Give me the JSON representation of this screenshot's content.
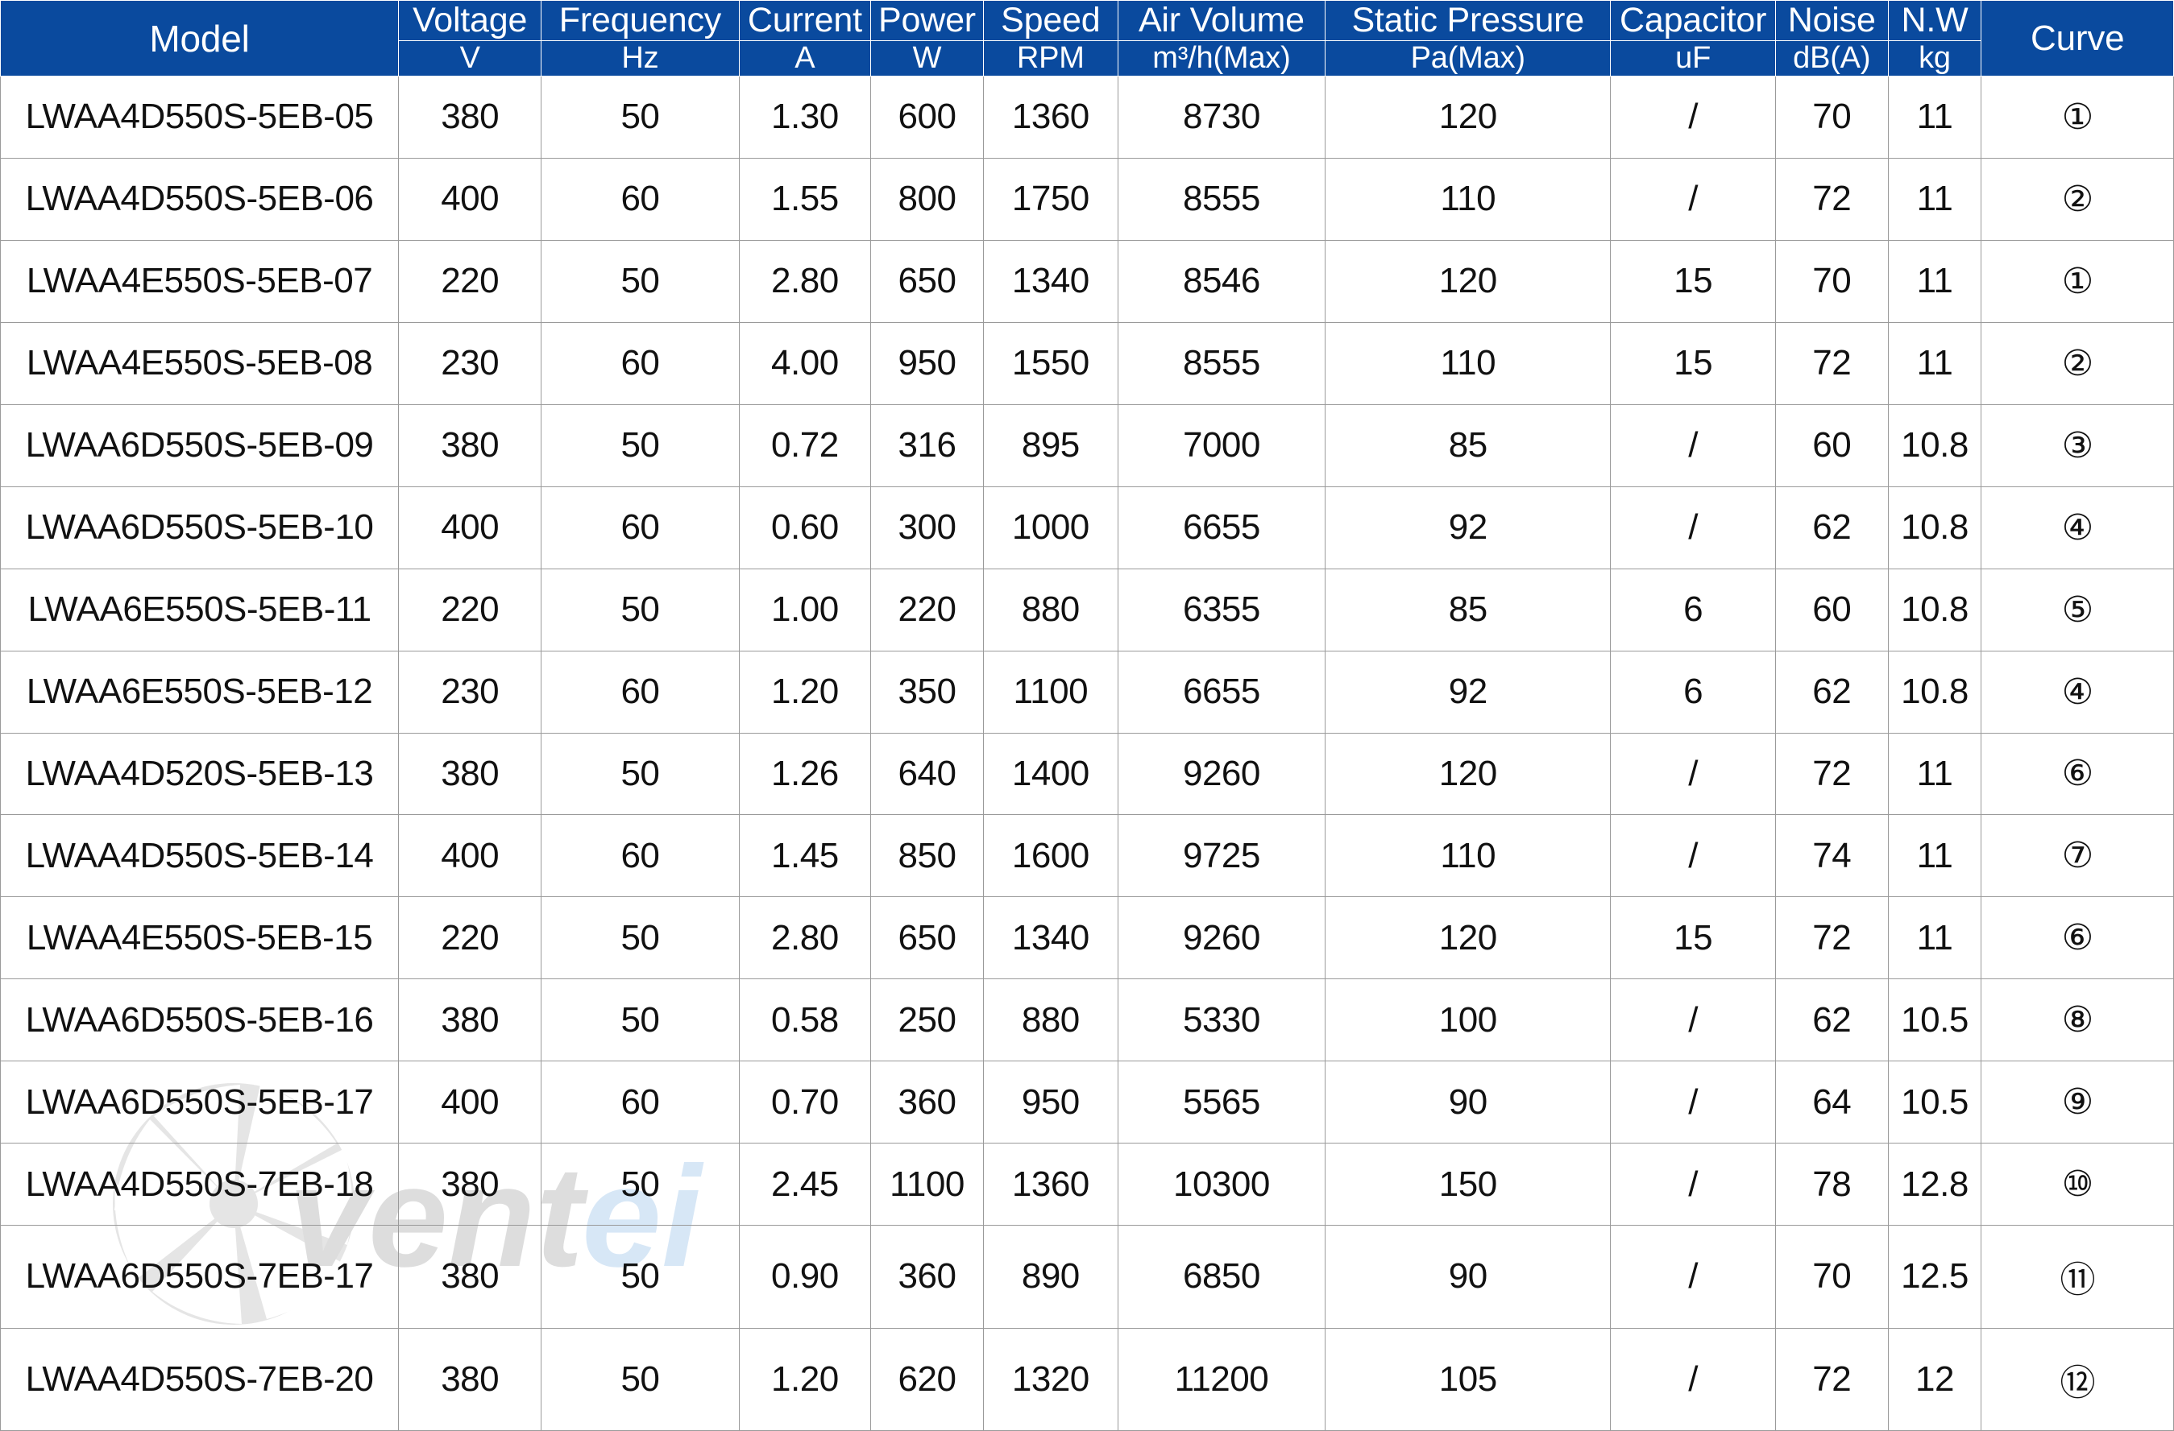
{
  "watermark": {
    "text_primary": "vent",
    "text_accent": "ei",
    "logo_name": "fan-impeller-logo",
    "color_gray": "#c9c9c9",
    "color_blue": "#bfd9f2"
  },
  "colors": {
    "header_blue": "#0a4a9e",
    "header_text": "#ffffff",
    "grid_line": "#9a9a9a",
    "body_text": "#111111"
  },
  "table": {
    "columns": [
      {
        "key": "model",
        "title": "Model",
        "unit": ""
      },
      {
        "key": "voltage",
        "title": "Voltage",
        "unit": "V"
      },
      {
        "key": "frequency",
        "title": "Frequency",
        "unit": "Hz"
      },
      {
        "key": "current",
        "title": "Current",
        "unit": "A"
      },
      {
        "key": "power",
        "title": "Power",
        "unit": "W"
      },
      {
        "key": "speed",
        "title": "Speed",
        "unit": "RPM"
      },
      {
        "key": "air",
        "title": "Air Volume",
        "unit": "m³/h(Max)"
      },
      {
        "key": "pressure",
        "title": "Static Pressure",
        "unit": "Pa(Max)"
      },
      {
        "key": "capacitor",
        "title": "Capacitor",
        "unit": "uF"
      },
      {
        "key": "noise",
        "title": "Noise",
        "unit": "dB(A)"
      },
      {
        "key": "nw",
        "title": "N.W",
        "unit": "kg"
      },
      {
        "key": "curve",
        "title": "Curve",
        "unit": ""
      }
    ],
    "rows": [
      {
        "model": "LWAA4D550S-5EB-05",
        "voltage": "380",
        "frequency": "50",
        "current": "1.30",
        "power": "600",
        "speed": "1360",
        "air": "8730",
        "pressure": "120",
        "capacitor": "/",
        "noise": "70",
        "nw": "11",
        "curve": "①"
      },
      {
        "model": "LWAA4D550S-5EB-06",
        "voltage": "400",
        "frequency": "60",
        "current": "1.55",
        "power": "800",
        "speed": "1750",
        "air": "8555",
        "pressure": "110",
        "capacitor": "/",
        "noise": "72",
        "nw": "11",
        "curve": "②"
      },
      {
        "model": "LWAA4E550S-5EB-07",
        "voltage": "220",
        "frequency": "50",
        "current": "2.80",
        "power": "650",
        "speed": "1340",
        "air": "8546",
        "pressure": "120",
        "capacitor": "15",
        "noise": "70",
        "nw": "11",
        "curve": "①"
      },
      {
        "model": "LWAA4E550S-5EB-08",
        "voltage": "230",
        "frequency": "60",
        "current": "4.00",
        "power": "950",
        "speed": "1550",
        "air": "8555",
        "pressure": "110",
        "capacitor": "15",
        "noise": "72",
        "nw": "11",
        "curve": "②"
      },
      {
        "model": "LWAA6D550S-5EB-09",
        "voltage": "380",
        "frequency": "50",
        "current": "0.72",
        "power": "316",
        "speed": "895",
        "air": "7000",
        "pressure": "85",
        "capacitor": "/",
        "noise": "60",
        "nw": "10.8",
        "curve": "③"
      },
      {
        "model": "LWAA6D550S-5EB-10",
        "voltage": "400",
        "frequency": "60",
        "current": "0.60",
        "power": "300",
        "speed": "1000",
        "air": "6655",
        "pressure": "92",
        "capacitor": "/",
        "noise": "62",
        "nw": "10.8",
        "curve": "④"
      },
      {
        "model": "LWAA6E550S-5EB-11",
        "voltage": "220",
        "frequency": "50",
        "current": "1.00",
        "power": "220",
        "speed": "880",
        "air": "6355",
        "pressure": "85",
        "capacitor": "6",
        "noise": "60",
        "nw": "10.8",
        "curve": "⑤"
      },
      {
        "model": "LWAA6E550S-5EB-12",
        "voltage": "230",
        "frequency": "60",
        "current": "1.20",
        "power": "350",
        "speed": "1100",
        "air": "6655",
        "pressure": "92",
        "capacitor": "6",
        "noise": "62",
        "nw": "10.8",
        "curve": "④"
      },
      {
        "model": "LWAA4D520S-5EB-13",
        "voltage": "380",
        "frequency": "50",
        "current": "1.26",
        "power": "640",
        "speed": "1400",
        "air": "9260",
        "pressure": "120",
        "capacitor": "/",
        "noise": "72",
        "nw": "11",
        "curve": "⑥"
      },
      {
        "model": "LWAA4D550S-5EB-14",
        "voltage": "400",
        "frequency": "60",
        "current": "1.45",
        "power": "850",
        "speed": "1600",
        "air": "9725",
        "pressure": "110",
        "capacitor": "/",
        "noise": "74",
        "nw": "11",
        "curve": "⑦"
      },
      {
        "model": "LWAA4E550S-5EB-15",
        "voltage": "220",
        "frequency": "50",
        "current": "2.80",
        "power": "650",
        "speed": "1340",
        "air": "9260",
        "pressure": "120",
        "capacitor": "15",
        "noise": "72",
        "nw": "11",
        "curve": "⑥"
      },
      {
        "model": "LWAA6D550S-5EB-16",
        "voltage": "380",
        "frequency": "50",
        "current": "0.58",
        "power": "250",
        "speed": "880",
        "air": "5330",
        "pressure": "100",
        "capacitor": "/",
        "noise": "62",
        "nw": "10.5",
        "curve": "⑧"
      },
      {
        "model": "LWAA6D550S-5EB-17",
        "voltage": "400",
        "frequency": "60",
        "current": "0.70",
        "power": "360",
        "speed": "950",
        "air": "5565",
        "pressure": "90",
        "capacitor": "/",
        "noise": "64",
        "nw": "10.5",
        "curve": "⑨"
      },
      {
        "model": "LWAA4D550S-7EB-18",
        "voltage": "380",
        "frequency": "50",
        "current": "2.45",
        "power": "1100",
        "speed": "1360",
        "air": "10300",
        "pressure": "150",
        "capacitor": "/",
        "noise": "78",
        "nw": "12.8",
        "curve": "⑩"
      },
      {
        "model": "LWAA6D550S-7EB-17",
        "voltage": "380",
        "frequency": "50",
        "current": "0.90",
        "power": "360",
        "speed": "890",
        "air": "6850",
        "pressure": "90",
        "capacitor": "/",
        "noise": "70",
        "nw": "12.5",
        "curve": "⑪"
      },
      {
        "model": "LWAA4D550S-7EB-20",
        "voltage": "380",
        "frequency": "50",
        "current": "1.20",
        "power": "620",
        "speed": "1320",
        "air": "11200",
        "pressure": "105",
        "capacitor": "/",
        "noise": "72",
        "nw": "12",
        "curve": "⑫"
      }
    ]
  }
}
